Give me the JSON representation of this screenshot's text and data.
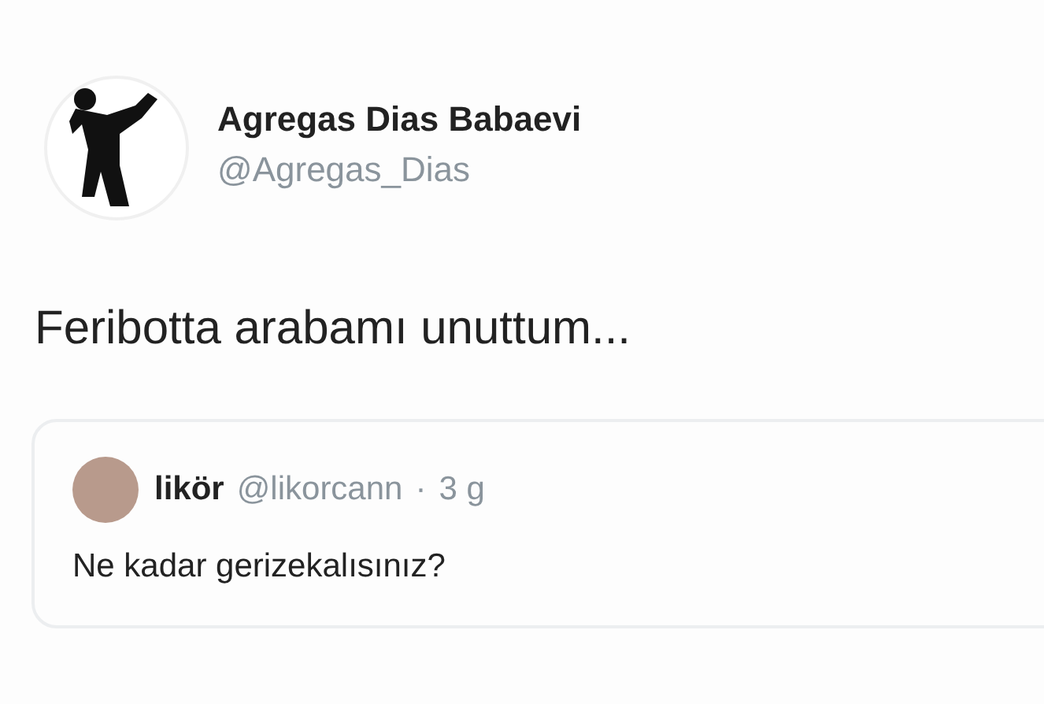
{
  "tweet": {
    "author": {
      "name": "Agregas Dias Babaevi",
      "handle": "@Agregas_Dias"
    },
    "text": "Feribotta arabamı unuttum...",
    "quoted_tweet": {
      "author": {
        "name": "likör",
        "handle": "@likorcann"
      },
      "separator": "·",
      "time": "3 g",
      "text": "Ne kadar gerizekalısınız?"
    }
  }
}
